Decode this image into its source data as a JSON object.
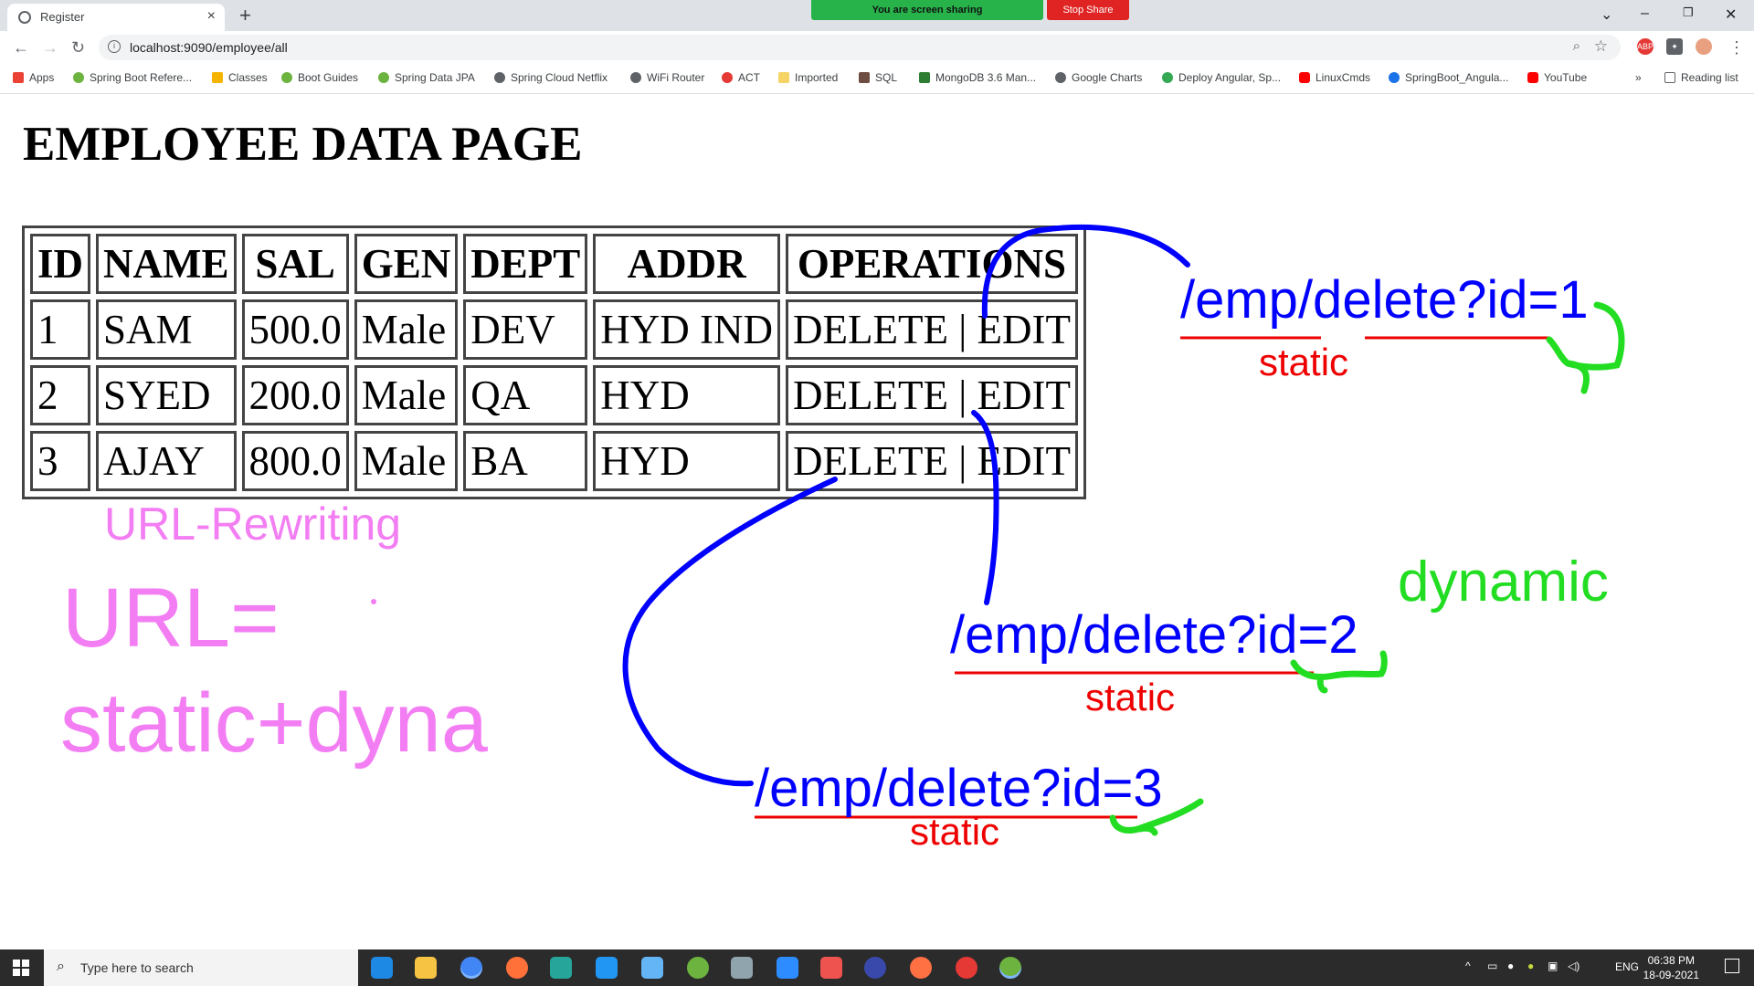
{
  "browser": {
    "tab_title": "Register",
    "tab_close": "×",
    "new_tab": "+",
    "url": "localhost:9090/employee/all",
    "share_message": "You are screen sharing",
    "stop_share": "Stop Share",
    "reading_list": "Reading list",
    "more_bookmarks": "»",
    "bookmarks": [
      {
        "label": "Apps",
        "color": "#ea4335"
      },
      {
        "label": "Spring Boot Refere...",
        "color": "#6db33f"
      },
      {
        "label": "Classes",
        "color": "#f4b400"
      },
      {
        "label": "Boot Guides",
        "color": "#6db33f"
      },
      {
        "label": "Spring Data JPA",
        "color": "#6db33f"
      },
      {
        "label": "Spring Cloud Netflix",
        "color": "#5f6368"
      },
      {
        "label": "WiFi Router",
        "color": "#5f6368"
      },
      {
        "label": "ACT",
        "color": "#e53935"
      },
      {
        "label": "Imported",
        "color": "#f6d365"
      },
      {
        "label": "SQL",
        "color": "#6d4c41"
      },
      {
        "label": "MongoDB 3.6 Man...",
        "color": "#2e7d32"
      },
      {
        "label": "Google Charts",
        "color": "#5f6368"
      },
      {
        "label": "Deploy Angular, Sp...",
        "color": "#34a853"
      },
      {
        "label": "LinuxCmds",
        "color": "#ff0000"
      },
      {
        "label": "SpringBoot_Angula...",
        "color": "#1a73e8"
      },
      {
        "label": "YouTube",
        "color": "#ff0000"
      }
    ]
  },
  "page": {
    "title": "EMPLOYEE DATA PAGE",
    "table": {
      "headers": [
        "ID",
        "NAME",
        "SAL",
        "GEN",
        "DEPT",
        "ADDR",
        "OPERATIONS"
      ],
      "rows": [
        {
          "id": "1",
          "name": "SAM",
          "sal": "500.0",
          "gen": "Male",
          "dept": "DEV",
          "addr": "HYD IND",
          "delete": "DELETE",
          "sep": "|",
          "edit": "EDIT"
        },
        {
          "id": "2",
          "name": "SYED",
          "sal": "200.0",
          "gen": "Male",
          "dept": "QA",
          "addr": "HYD",
          "delete": "DELETE",
          "sep": "|",
          "edit": "EDIT"
        },
        {
          "id": "3",
          "name": "AJAY",
          "sal": "800.0",
          "gen": "Male",
          "dept": "BA",
          "addr": "HYD",
          "delete": "DELETE",
          "sep": "|",
          "edit": "EDIT"
        }
      ]
    }
  },
  "annotations": {
    "url_rewriting": "URL-Rewriting",
    "url_eq": "URL=",
    "static_dyna": "static+dyna",
    "link1": "/emp/delete?id=1",
    "link2": "/emp/delete?id=2",
    "link3": "/emp/delete?id=3",
    "static_label": "static",
    "dynamic_label": "dynamic",
    "colors": {
      "pink": "#f37ef3",
      "blue": "#0000ff",
      "red": "#ee0000",
      "green": "#22dd22"
    }
  },
  "taskbar": {
    "search_placeholder": "Type here to search",
    "language": "ENG",
    "time": "06:38 PM",
    "date": "18-09-2021"
  }
}
